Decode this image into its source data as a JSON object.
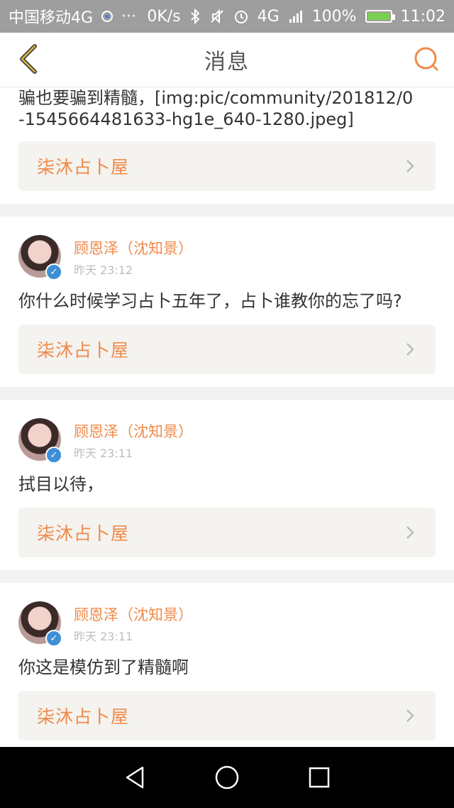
{
  "status_bar": {
    "carrier": "中国移动4G",
    "dots": "···",
    "speed": "0K/s",
    "network": "4G",
    "battery_pct": "100%",
    "time": "11:02"
  },
  "header": {
    "title": "消息",
    "accent_color": "#f08a4b"
  },
  "top_partial": {
    "text": "骗也要骗到精髓，[img:pic/community/201812/0-1545664481633-hg1e_640-1280.jpeg]",
    "quote_title": "柒沐占卜屋"
  },
  "messages": [
    {
      "user_name": "顾恩泽（沈知景）",
      "time": "昨天 23:12",
      "text": "你什么时候学习占卜五年了，占卜谁教你的忘了吗?",
      "quote_title": "柒沐占卜屋"
    },
    {
      "user_name": "顾恩泽（沈知景）",
      "time": "昨天 23:11",
      "text": "拭目以待，",
      "quote_title": "柒沐占卜屋"
    },
    {
      "user_name": "顾恩泽（沈知景）",
      "time": "昨天 23:11",
      "text": "你这是模仿到了精髓啊",
      "quote_title": "柒沐占卜屋"
    }
  ]
}
